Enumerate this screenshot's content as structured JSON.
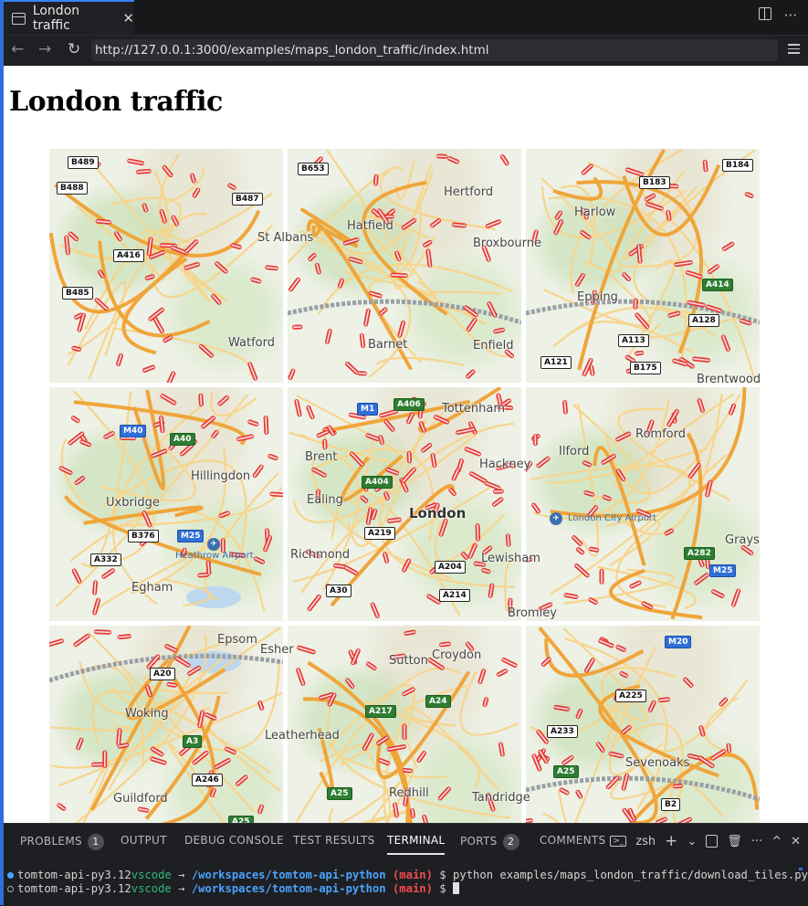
{
  "tab": {
    "title": "London traffic",
    "close": "✕"
  },
  "toolbar": {
    "split_icon": "split-editor-icon",
    "more": "···"
  },
  "nav": {
    "back": "←",
    "forward": "→",
    "reload": "↻",
    "url": "http://127.0.0.1:3000/examples/maps_london_traffic/index.html"
  },
  "page": {
    "heading": "London traffic"
  },
  "map": {
    "road_labels": [
      "B489",
      "B488",
      "B487",
      "A416",
      "B485",
      "B653",
      "B183",
      "B184",
      "A414",
      "A128",
      "A121",
      "A113",
      "B175",
      "M1",
      "A406",
      "M40",
      "A40",
      "A404",
      "B376",
      "A332",
      "A219",
      "M25",
      "A204",
      "A30",
      "A214",
      "A20",
      "M25",
      "A282",
      "M20",
      "A225",
      "A233",
      "A246",
      "A217",
      "A24",
      "A3",
      "B2",
      "A25",
      "A25",
      "A25"
    ],
    "places": [
      "St Albans",
      "Watford",
      "Hatfield",
      "Hertford",
      "Broxbourne",
      "Barnet",
      "Enfield",
      "Epping",
      "Harlow",
      "Brentwood",
      "Tottenham",
      "Hillingdon",
      "Uxbridge",
      "Ealing",
      "Brent",
      "Hackney",
      "London",
      "Ilford",
      "Romford",
      "Richmond",
      "Egham",
      "Lewisham",
      "Bromley",
      "Grays",
      "Woking",
      "Leatherhead",
      "Croydon",
      "Sutton",
      "Epsom",
      "Guildford",
      "Redhill",
      "Tandridge",
      "Sevenoaks",
      "Esher"
    ],
    "airports": [
      "Heathrow Airport",
      "London City Airport"
    ]
  },
  "panel": {
    "tabs": [
      {
        "label": "PROBLEMS",
        "badge": "1"
      },
      {
        "label": "OUTPUT"
      },
      {
        "label": "DEBUG CONSOLE"
      },
      {
        "label": "TEST RESULTS"
      },
      {
        "label": "TERMINAL"
      },
      {
        "label": "PORTS",
        "badge": "2"
      },
      {
        "label": "COMMENTS"
      }
    ],
    "shell": "zsh",
    "controls": [
      "+",
      "⌄",
      "split-terminal-icon",
      "trash-icon",
      "···",
      "^",
      "✕"
    ]
  },
  "terminal": {
    "line1": {
      "env": "tomtom-api-py3.12",
      "user": "vscode",
      "arrow": "→",
      "path": "/workspaces/tomtom-api-python",
      "branch": "(main)",
      "prompt": "$",
      "command": "python examples/maps_london_traffic/download_tiles.py"
    },
    "line2": {
      "env": "tomtom-api-py3.12",
      "user": "vscode",
      "arrow": "→",
      "path": "/workspaces/tomtom-api-python",
      "branch": "(main)",
      "prompt": "$",
      "command": ""
    }
  },
  "colors": {
    "accent": "#3b82f6",
    "traffic_red": "#e53935",
    "road_yellow": "#f7c86a",
    "road_orange": "#f0a030"
  }
}
